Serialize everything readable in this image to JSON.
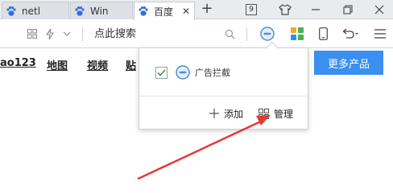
{
  "tabs": [
    {
      "label": "netl",
      "active": false
    },
    {
      "label": "Win",
      "active": false
    },
    {
      "label": "百度",
      "active": true,
      "close": "✕"
    }
  ],
  "window": {
    "tab_count": "9"
  },
  "toolbar": {
    "search_placeholder": "点此搜索"
  },
  "nav_links": [
    "ao123",
    "地图",
    "视频",
    "贴"
  ],
  "more_button": "更多产品",
  "popup": {
    "extension_name": "广告拦截",
    "extension_checked": true,
    "add_label": "添加",
    "manage_label": "管理"
  },
  "colors": {
    "accent": "#3a8ff0",
    "arrow": "#e53935",
    "check": "#2e9e4f",
    "adblock_icon": "#4a90d9"
  }
}
